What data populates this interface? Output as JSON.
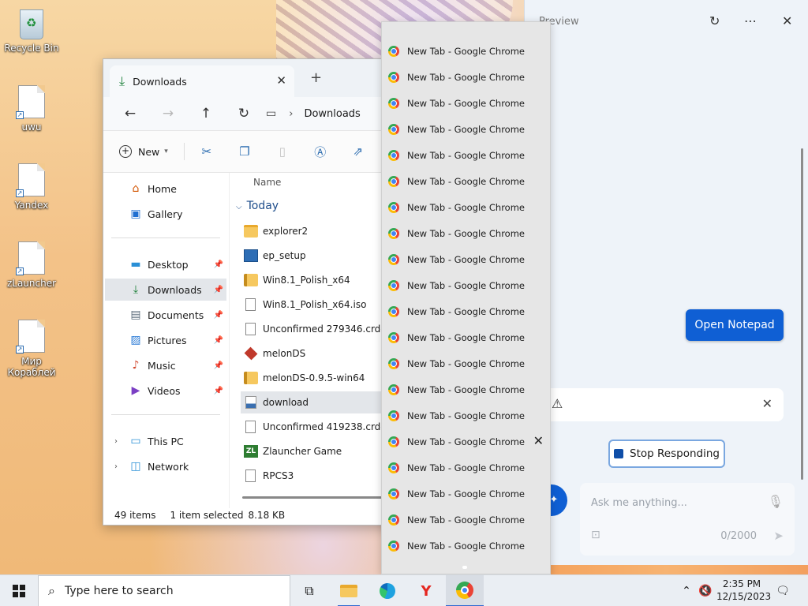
{
  "desktop": {
    "icons": [
      {
        "label": "Recycle Bin"
      },
      {
        "label": "uwu"
      },
      {
        "label": "Yandex"
      },
      {
        "label": "zLauncher"
      },
      {
        "label": "Мир Кораблей"
      }
    ]
  },
  "explorer": {
    "tab_title": "Downloads",
    "address": "Downloads",
    "new_label": "New",
    "sidebar": {
      "home": "Home",
      "gallery": "Gallery",
      "desktop": "Desktop",
      "downloads": "Downloads",
      "documents": "Documents",
      "pictures": "Pictures",
      "music": "Music",
      "videos": "Videos",
      "this_pc": "This PC",
      "network": "Network"
    },
    "column_name": "Name",
    "group_today": "Today",
    "files": [
      {
        "name": "explorer2",
        "icon": "folder-icon"
      },
      {
        "name": "ep_setup",
        "icon": "installer-icon"
      },
      {
        "name": "Win8.1_Polish_x64",
        "icon": "zip-folder-icon"
      },
      {
        "name": "Win8.1_Polish_x64.iso",
        "icon": "file-icon"
      },
      {
        "name": "Unconfirmed 279346.crdownload",
        "icon": "file-icon"
      },
      {
        "name": "melonDS",
        "icon": "melon-icon"
      },
      {
        "name": "melonDS-0.9.5-win64",
        "icon": "zip-folder-icon"
      },
      {
        "name": "download",
        "icon": "download-file-icon"
      },
      {
        "name": "Unconfirmed 419238.crdownload",
        "icon": "file-icon"
      },
      {
        "name": "Zlauncher Game",
        "icon": "zlauncher-icon"
      },
      {
        "name": "RPCS3",
        "icon": "file-icon"
      }
    ],
    "status": {
      "items": "49 items",
      "selected": "1 item selected",
      "size": "8.18 KB"
    }
  },
  "tab_list": {
    "item_label": "New Tab - Google Chrome",
    "count": 20,
    "hovered_index": 15
  },
  "copilot": {
    "title": "Preview",
    "open_notepad": "Open Notepad",
    "stop_responding": "Stop Responding",
    "ask_placeholder": "Ask me anything...",
    "char_count": "0/2000"
  },
  "taskbar": {
    "search_placeholder": "Type here to search",
    "time": "2:35 PM",
    "date": "12/15/2023"
  }
}
